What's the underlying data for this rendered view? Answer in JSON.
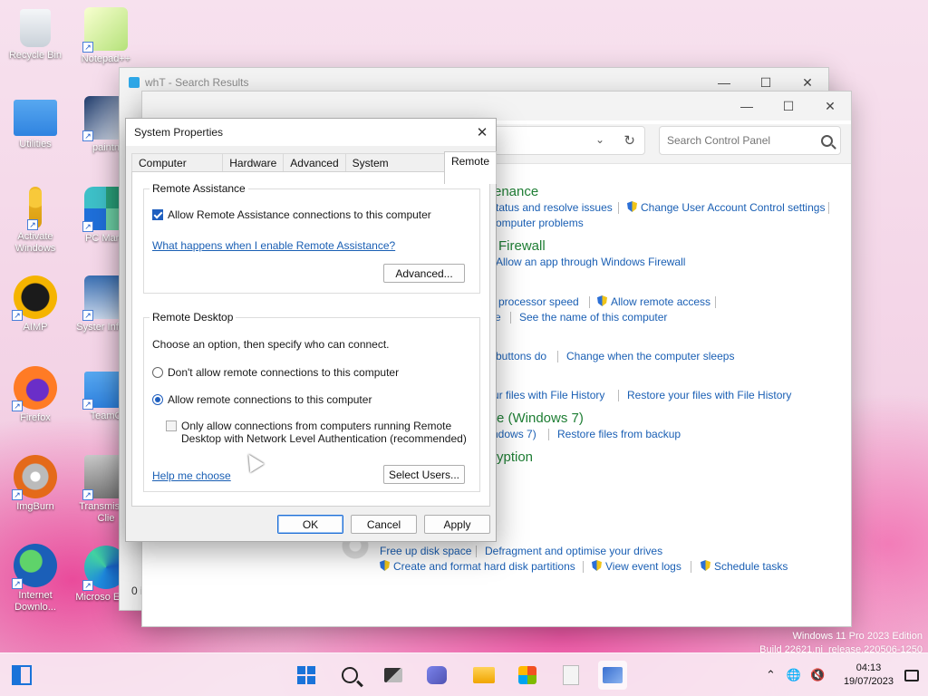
{
  "desktop": {
    "icons": [
      {
        "label": "Recycle Bin",
        "icon": "recycle-bin-icon"
      },
      {
        "label": "Notepad++",
        "icon": "notepad-plus-plus-icon"
      },
      {
        "label": "Utilities",
        "icon": "folder-icon"
      },
      {
        "label": "paintn",
        "icon": "paint-icon"
      },
      {
        "label": "Activate Windows",
        "icon": "key-icon"
      },
      {
        "label": "PC Mana",
        "icon": "pc-manager-icon"
      },
      {
        "label": "AIMP",
        "icon": "aimp-icon"
      },
      {
        "label": "Syster Inform",
        "icon": "system-information-icon"
      },
      {
        "label": "Firefox",
        "icon": "firefox-icon"
      },
      {
        "label": "TeamC",
        "icon": "folder-icon"
      },
      {
        "label": "ImgBurn",
        "icon": "imgburn-icon"
      },
      {
        "label": "Transmis Qt Clie",
        "icon": "transmission-icon"
      },
      {
        "label": "Internet Downlo...",
        "icon": "internet-download-manager-icon"
      },
      {
        "label": "Microso Edge",
        "icon": "edge-icon"
      }
    ]
  },
  "search_window": {
    "title": "whT - Search Results",
    "status_text": "0 i"
  },
  "control_panel": {
    "search_placeholder": "Search Control Panel",
    "sections": [
      {
        "heading": "enance",
        "links": [
          "tatus and resolve issues",
          "Change User Account Control settings",
          "omputer problems"
        ]
      },
      {
        "heading": "Firewall",
        "links": [
          "Allow an app through Windows Firewall"
        ]
      },
      {
        "heading": "",
        "links": [
          "processor speed",
          "Allow remote access",
          "e",
          "See the name of this computer"
        ]
      },
      {
        "heading": "",
        "links": [
          "buttons do",
          "Change when the computer sleeps"
        ]
      },
      {
        "heading": "",
        "links": [
          "ur files with File History",
          "Restore your files with File History"
        ]
      },
      {
        "heading": "re (Windows 7)",
        "links": [
          "ndows 7)",
          "Restore files from backup"
        ]
      },
      {
        "heading": "ryption",
        "links": []
      },
      {
        "heading": "",
        "links": [
          "Free up disk space",
          "Defragment and optimise your drives",
          "Create and format hard disk partitions",
          "View event logs",
          "Schedule tasks"
        ]
      }
    ]
  },
  "system_properties": {
    "title": "System Properties",
    "tabs": [
      "Computer Name",
      "Hardware",
      "Advanced",
      "System Protection",
      "Remote"
    ],
    "active_tab": "Remote",
    "remote_assistance": {
      "group_title": "Remote Assistance",
      "allow_label": "Allow Remote Assistance connections to this computer",
      "allow_checked": true,
      "help_link": "What happens when I enable Remote Assistance?",
      "advanced_button": "Advanced..."
    },
    "remote_desktop": {
      "group_title": "Remote Desktop",
      "instruction": "Choose an option, then specify who can connect.",
      "option_dont_allow": "Don't allow remote connections to this computer",
      "option_allow": "Allow remote connections to this computer",
      "selected_option": "allow",
      "nla_label_line1": "Only allow connections from computers running Remote",
      "nla_label_line2": "Desktop with Network Level Authentication (recommended)",
      "nla_checked": false,
      "help_link": "Help me choose",
      "select_users_button": "Select Users..."
    },
    "buttons": {
      "ok": "OK",
      "cancel": "Cancel",
      "apply": "Apply"
    }
  },
  "watermark": {
    "line1": "Windows 11 Pro 2023 Edition",
    "line2": "Build 22621.ni_release.220506-1250"
  },
  "taskbar": {
    "items": [
      "start-icon",
      "search-icon",
      "task-view-icon",
      "teams-chat-icon",
      "file-explorer-icon",
      "microsoft-store-icon",
      "notepad-icon",
      "control-panel-icon"
    ],
    "clock_time": "04:13",
    "clock_date": "19/07/2023"
  },
  "colors": {
    "link": "#1a5fb4",
    "heading_green": "#1e7e34",
    "accent_blue": "#1f5fbf"
  }
}
